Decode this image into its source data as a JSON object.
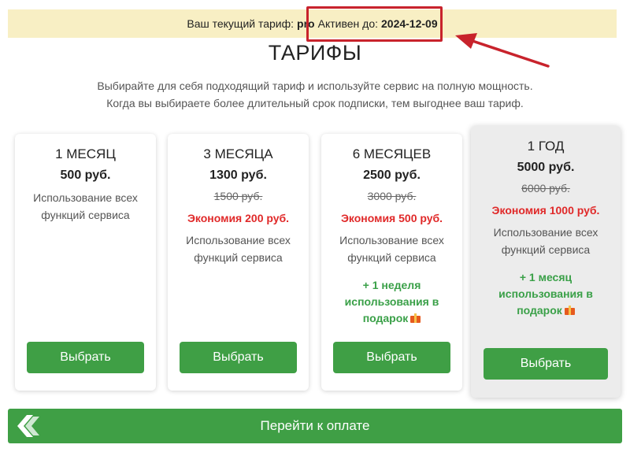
{
  "status": {
    "prefix": "Ваш текущий тариф:",
    "plan": "pro",
    "active_label": "Активен до:",
    "active_date": "2024-12-09"
  },
  "page": {
    "title": "ТАРИФЫ",
    "subtitle_line1": "Выбирайте для себя подходящий тариф и используйте сервис на полную мощность.",
    "subtitle_line2": "Когда вы выбираете более длительный срок подписки, тем выгоднее ваш тариф."
  },
  "plans": [
    {
      "period": "1 МЕСЯЦ",
      "price": "500 руб.",
      "desc": "Использование всех функций сервиса",
      "button": "Выбрать"
    },
    {
      "period": "3 МЕСЯЦА",
      "price": "1300 руб.",
      "old_price": "1500 руб.",
      "saving": "Экономия 200 руб.",
      "desc": "Использование всех функций сервиса",
      "button": "Выбрать"
    },
    {
      "period": "6 МЕСЯЦЕВ",
      "price": "2500 руб.",
      "old_price": "3000 руб.",
      "saving": "Экономия 500 руб.",
      "desc": "Использование всех функций сервиса",
      "bonus": "+ 1 неделя использования в подарок",
      "button": "Выбрать"
    },
    {
      "period": "1 ГОД",
      "price": "5000 руб.",
      "old_price": "6000 руб.",
      "saving": "Экономия 1000 руб.",
      "desc": "Использование всех функций сервиса",
      "bonus": "+ 1 месяц использования в подарок",
      "button": "Выбрать"
    }
  ],
  "payment": {
    "label": "Перейти к оплате"
  },
  "colors": {
    "accent_green": "#3f9f45",
    "bonus_green": "#3aa048",
    "saving_red": "#e02929",
    "highlight_red": "#c8232c",
    "status_bg": "#f8efc4"
  },
  "icons": {
    "gift": "gift-icon",
    "pay_logo": "payment-logo-icon",
    "annotation_arrow": "arrow-icon"
  }
}
